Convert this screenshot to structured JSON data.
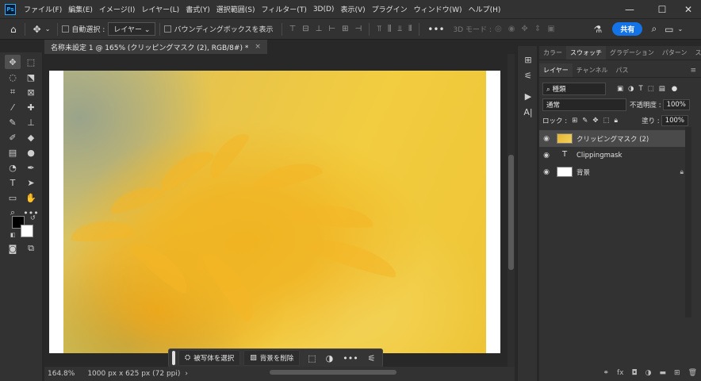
{
  "app": {
    "logo": "Ps"
  },
  "menu": [
    "ファイル(F)",
    "編集(E)",
    "イメージ(I)",
    "レイヤー(L)",
    "書式(Y)",
    "選択範囲(S)",
    "フィルター(T)",
    "3D(D)",
    "表示(V)",
    "プラグイン",
    "ウィンドウ(W)",
    "ヘルプ(H)"
  ],
  "window_controls": {
    "minimize": "—",
    "maximize": "☐",
    "close": "✕"
  },
  "options": {
    "auto_select_label": "自動選択 :",
    "auto_select_target": "レイヤー",
    "bounding_box_label": "バウンディングボックスを表示",
    "mode_3d_label": "3D モード :",
    "share_label": "共有"
  },
  "document": {
    "tab_title": "名称未設定 1 @ 165% (クリッピングマスク (2), RGB/8#) *",
    "close": "×",
    "zoom": "164.8%",
    "size_info": "1000 px x 625 px (72 ppi)"
  },
  "context_bar": {
    "select_subject": "被写体を選択",
    "remove_background": "背景を削除",
    "more": "•••"
  },
  "panels": {
    "top_tabs": [
      "カラー",
      "スウォッチ",
      "グラデーション",
      "パターン",
      "スタイル"
    ],
    "top_active": 1,
    "layer_tabs": [
      "レイヤー",
      "チャンネル",
      "パス"
    ],
    "layer_active": 0,
    "filter_kind": "種類",
    "blend_mode": "通常",
    "opacity_label": "不透明度 :",
    "opacity_value": "100%",
    "lock_label": "ロック :",
    "fill_label": "塗り :",
    "fill_value": "100%"
  },
  "layers": [
    {
      "name": "クリッピングマスク (2)",
      "selected": true,
      "type": "clipped-image"
    },
    {
      "name": "Clippingmask",
      "selected": false,
      "type": "text"
    },
    {
      "name": "背景",
      "selected": false,
      "type": "background",
      "locked": true
    }
  ],
  "colors": {
    "accent": "#1473e6",
    "panel_bg": "#323232",
    "canvas_bg": "#282828"
  }
}
